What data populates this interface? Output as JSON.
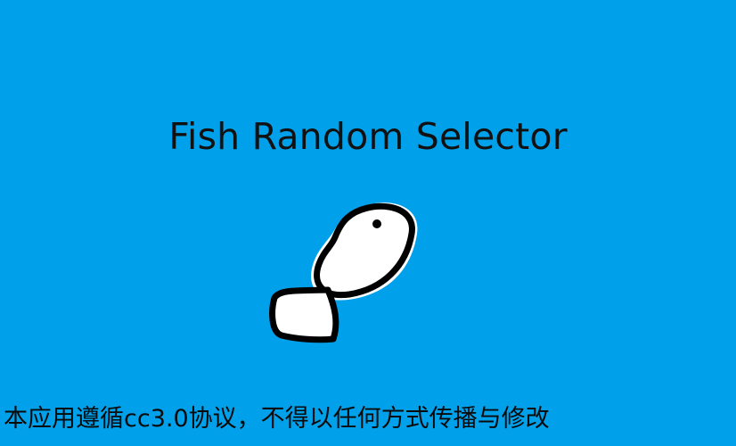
{
  "app": {
    "title": "Fish Random Selector"
  },
  "logo": {
    "icon": "fish-icon"
  },
  "footer": {
    "license_notice": "本应用遵循cc3.0协议，不得以任何方式传播与修改"
  },
  "colors": {
    "background": "#00A1EA",
    "text": "#111111",
    "fish_fill": "#FFFFFF",
    "fish_outline": "#000000"
  }
}
